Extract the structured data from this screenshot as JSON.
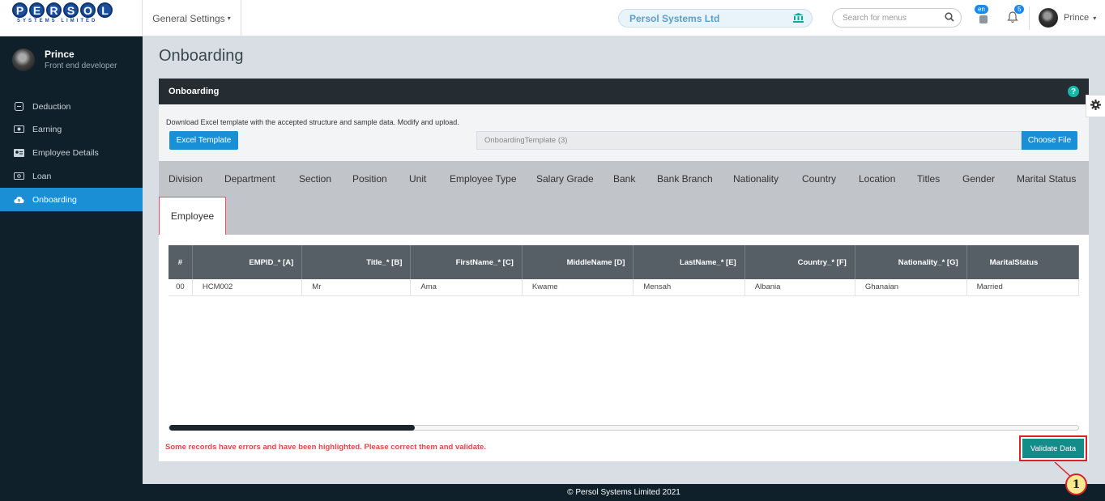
{
  "brand": {
    "letters": [
      "P",
      "E",
      "R",
      "S",
      "O",
      "L"
    ],
    "subtitle": "SYSTEMS LIMITED"
  },
  "topbar": {
    "general_settings": "General Settings",
    "company": "Persol Systems Ltd",
    "search_placeholder": "Search for menus",
    "lang_badge": "en",
    "notif_badge": "5",
    "user_name": "Prince"
  },
  "sidebar": {
    "profile": {
      "name": "Prince",
      "role": "Front end developer"
    },
    "items": [
      {
        "label": "Deduction",
        "icon": "minus-square-icon",
        "active": false
      },
      {
        "label": "Earning",
        "icon": "money-icon",
        "active": false
      },
      {
        "label": "Employee Details",
        "icon": "id-card-icon",
        "active": false
      },
      {
        "label": "Loan",
        "icon": "cash-icon",
        "active": false
      },
      {
        "label": "Onboarding",
        "icon": "cloud-upload-icon",
        "active": true
      }
    ]
  },
  "page": {
    "title": "Onboarding",
    "card_title": "Onboarding",
    "help": "?",
    "upload_description": "Download Excel template with the accepted structure and sample data. Modify and upload.",
    "excel_template_button": "Excel Template",
    "file_name": "OnboardingTemplate (3)",
    "choose_file_button": "Choose File",
    "tabs": [
      "Division",
      "Department",
      "Section",
      "Position",
      "Unit",
      "Employee Type",
      "Salary Grade",
      "Bank",
      "Bank Branch",
      "Nationality",
      "Country",
      "Location",
      "Titles",
      "Gender",
      "Marital Status"
    ],
    "active_tab": "Employee",
    "table": {
      "headers": [
        "#",
        "EMPID_* [A]",
        "Title_* [B]",
        "FirstName_* [C]",
        "MiddleName [D]",
        "LastName_* [E]",
        "Country_* [F]",
        "Nationality_* [G]",
        "MaritalStatus"
      ],
      "rows": [
        [
          "00",
          "HCM002",
          "Mr",
          "Ama",
          "Kwame",
          "Mensah",
          "Albania",
          "Ghanaian",
          "Married"
        ]
      ]
    },
    "scroll_progress": 0.27,
    "error_message": "Some records have errors and have been highlighted. Please correct them and validate.",
    "validate_button": "Validate Data"
  },
  "footer": "© Persol Systems Limited 2021",
  "callout": "1",
  "colors": {
    "primary": "#1a8fd6",
    "sidebar": "#10202a",
    "validate": "#138d8a",
    "error": "#e04848",
    "highlight": "#d6242a"
  }
}
